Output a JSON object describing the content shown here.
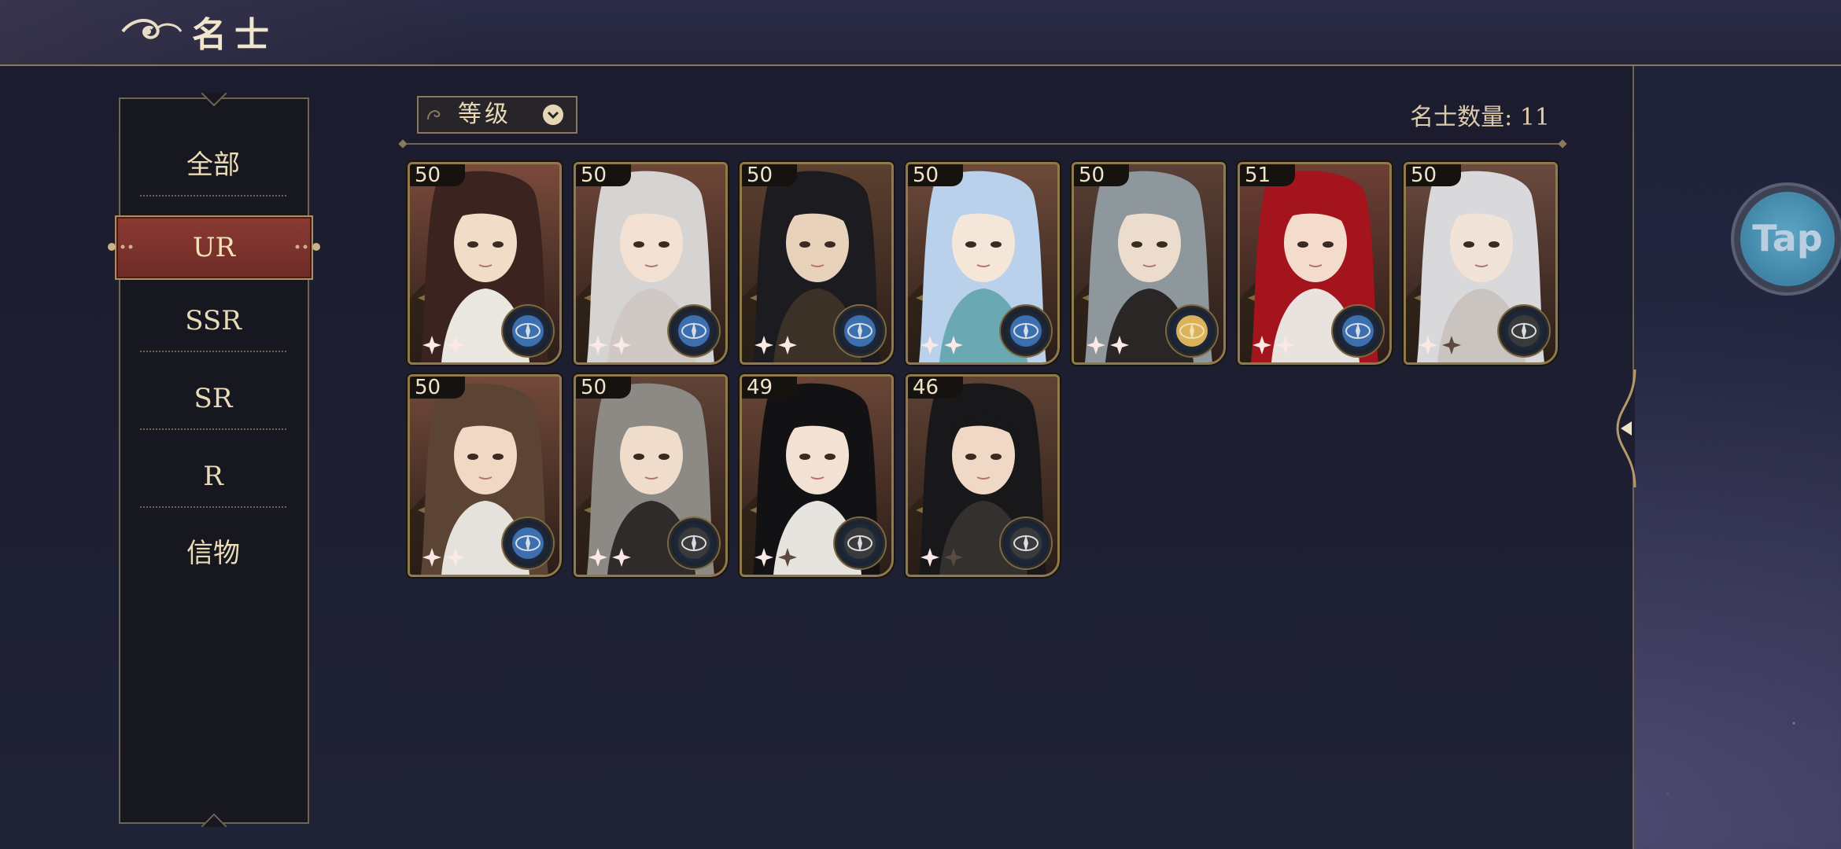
{
  "header": {
    "title": "名士"
  },
  "sidebar": {
    "items": [
      {
        "label": "全部"
      },
      {
        "label": "UR"
      },
      {
        "label": "SSR"
      },
      {
        "label": "SR"
      },
      {
        "label": "R"
      },
      {
        "label": "信物"
      }
    ],
    "active_index": 1
  },
  "toolbar": {
    "sort_label": "等级",
    "count_label": "名士数量: ",
    "count_value": "11"
  },
  "cards": [
    {
      "level": "50",
      "stars": 2,
      "hair": "#3b2420",
      "skin": "#f1dcc8",
      "outfit": "#eae6e0",
      "bg": "#7a4a3c",
      "badge": "blue"
    },
    {
      "level": "50",
      "stars": 2,
      "hair": "#d6d4d2",
      "skin": "#f3e2d4",
      "outfit": "#cfc8c4",
      "bg": "#6e4638",
      "badge": "blue"
    },
    {
      "level": "50",
      "stars": 2,
      "hair": "#1b1b20",
      "skin": "#e9d2bc",
      "outfit": "#3b3126",
      "bg": "#5c4030",
      "badge": "blue"
    },
    {
      "level": "50",
      "stars": 2,
      "hair": "#b9d1ea",
      "skin": "#f5e6da",
      "outfit": "#6aa8b4",
      "bg": "#6e4a3a",
      "badge": "blue"
    },
    {
      "level": "50",
      "stars": 2,
      "hair": "#8e979c",
      "skin": "#ecdccd",
      "outfit": "#2a2626",
      "bg": "#5a4036",
      "badge": "gold"
    },
    {
      "level": "51",
      "stars": 2,
      "hair": "#a3141c",
      "skin": "#f3dccb",
      "outfit": "#e8e3df",
      "bg": "#6d3f35",
      "badge": "blue"
    },
    {
      "level": "50",
      "stars": 1,
      "hair": "#d9d9dc",
      "skin": "#f2e3d8",
      "outfit": "#c9c4c0",
      "bg": "#6b4a3f",
      "badge": "dark"
    },
    {
      "level": "50",
      "stars": 2,
      "hair": "#5c4434",
      "skin": "#efd8c4",
      "outfit": "#e5e1dc",
      "bg": "#73493a",
      "badge": "blue"
    },
    {
      "level": "50",
      "stars": 2,
      "hair": "#8d8a86",
      "skin": "#efdccb",
      "outfit": "#2f2b2b",
      "bg": "#614337",
      "badge": "dark"
    },
    {
      "level": "49",
      "stars": 1,
      "hair": "#121214",
      "skin": "#f3e1d3",
      "outfit": "#e7e4e0",
      "bg": "#6a4536",
      "badge": "dark"
    },
    {
      "level": "46",
      "stars": 1,
      "hair": "#18171a",
      "skin": "#efd9c6",
      "outfit": "#34302e",
      "bg": "#5f4234",
      "badge": "dark"
    }
  ],
  "floating_button": {
    "label": "Tap"
  }
}
